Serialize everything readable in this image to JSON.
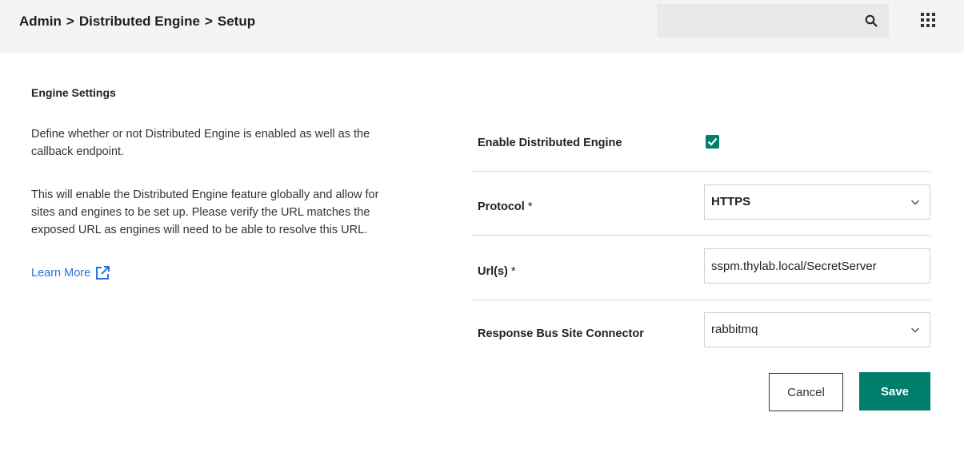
{
  "header": {
    "breadcrumb": [
      "Admin",
      "Distributed Engine",
      "Setup"
    ],
    "breadcrumb_separator": ">",
    "search": {
      "value": "",
      "placeholder": ""
    },
    "icons": {
      "search": "search-icon",
      "apps": "apps-grid-icon"
    }
  },
  "settings": {
    "title": "Engine Settings",
    "description_1": "Define whether or not Distributed Engine is enabled as well as the callback endpoint.",
    "description_2": "This will enable the Distributed Engine feature globally and allow for sites and engines to be set up. Please verify the URL matches the exposed URL as engines will need to be able to resolve this URL.",
    "learn_more": "Learn More"
  },
  "form": {
    "enable": {
      "label": "Enable Distributed Engine",
      "checked": true
    },
    "protocol": {
      "label": "Protocol",
      "required_mark": "*",
      "value": "HTTPS"
    },
    "urls": {
      "label": "Url(s)",
      "required_mark": "*",
      "value": "sspm.thylab.local/SecretServer"
    },
    "connector": {
      "label": "Response Bus Site Connector",
      "value": "rabbitmq"
    }
  },
  "actions": {
    "cancel": "Cancel",
    "save": "Save"
  },
  "colors": {
    "accent": "#007e6c",
    "link": "#2a6fdb",
    "header_bg": "#f4f4f4"
  }
}
